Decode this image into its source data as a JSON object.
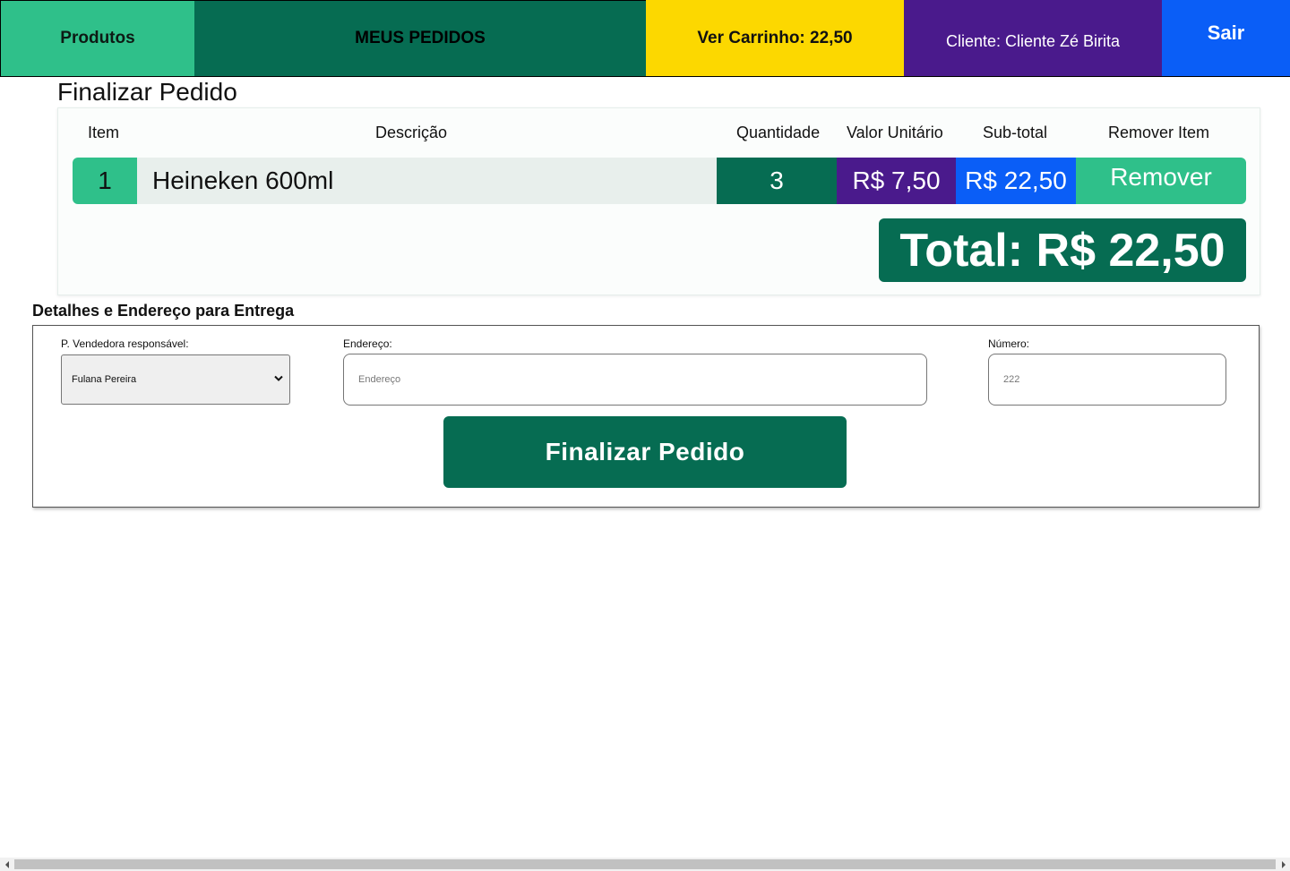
{
  "nav": {
    "produtos": "Produtos",
    "meus_pedidos": "MEUS PEDIDOS",
    "carrinho": "Ver Carrinho: 22,50",
    "cliente": "Cliente: Cliente Zé Birita",
    "sair": "Sair"
  },
  "page": {
    "title": "Finalizar Pedido"
  },
  "order": {
    "headers": {
      "item": "Item",
      "descricao": "Descrição",
      "quantidade": "Quantidade",
      "valor_unitario": "Valor Unitário",
      "sub_total": "Sub-total",
      "remover_item": "Remover Item"
    },
    "rows": [
      {
        "item": "1",
        "descricao": "Heineken 600ml",
        "quantidade": "3",
        "valor_unitario": "R$ 7,50",
        "sub_total": "R$ 22,50",
        "remover": "Remover"
      }
    ],
    "total": "Total: R$ 22,50"
  },
  "delivery": {
    "title": "Detalhes e Endereço para Entrega",
    "vendedora_label": "P. Vendedora responsável:",
    "vendedora_selected": "Fulana Pereira",
    "endereco_label": "Endereço:",
    "endereco_placeholder": "Endereço",
    "numero_label": "Número:",
    "numero_value": "222",
    "submit_label": "Finalizar Pedido"
  },
  "icons": {
    "select_chevron": "chevron-down-icon",
    "scroll_left": "arrow-left-icon",
    "scroll_right": "arrow-right-icon"
  },
  "colors": {
    "green_light": "#2fc08a",
    "green_dark": "#066c52",
    "yellow": "#fcd800",
    "purple": "#4a1a8c",
    "blue": "#0a5ef7"
  }
}
